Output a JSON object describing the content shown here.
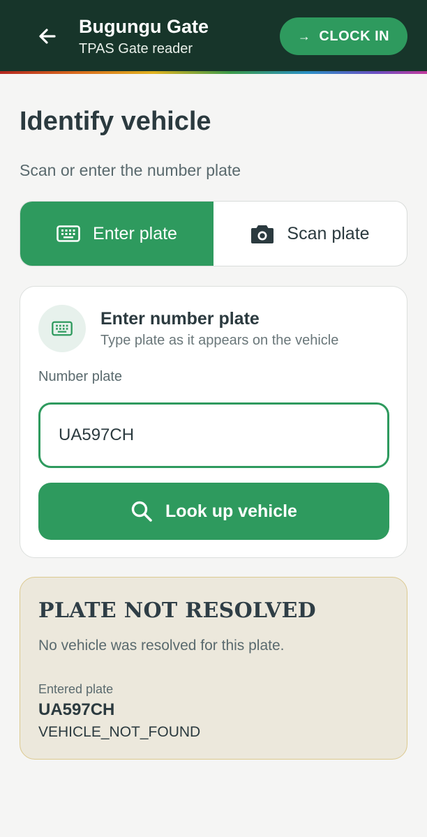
{
  "header": {
    "title": "Bugungu Gate",
    "subtitle": "TPAS Gate reader",
    "clock_in_label": "CLOCK IN",
    "clock_in_arrow": "→"
  },
  "page": {
    "title": "Identify vehicle",
    "subtitle": "Scan or enter the number plate"
  },
  "mode_toggle": {
    "options": [
      {
        "label": "Enter plate",
        "icon": "keypad-icon",
        "active": true
      },
      {
        "label": "Scan plate",
        "icon": "camera-icon",
        "active": false
      }
    ]
  },
  "entry_card": {
    "title": "Enter number plate",
    "subtitle": "Type plate as it appears on the vehicle",
    "field_label": "Number plate",
    "plate_value": "UA597CH",
    "lookup_label": "Look up vehicle"
  },
  "result": {
    "title": "PLATE NOT RESOLVED",
    "message": "No vehicle was resolved for this plate.",
    "entered_label": "Entered plate",
    "entered_value": "UA597CH",
    "error_code": "VEHICLE_NOT_FOUND"
  },
  "colors": {
    "header_bg": "#17352a",
    "accent_green": "#2e9a5e",
    "warning_bg": "#ece8dc",
    "warning_border": "#dcc98f"
  }
}
